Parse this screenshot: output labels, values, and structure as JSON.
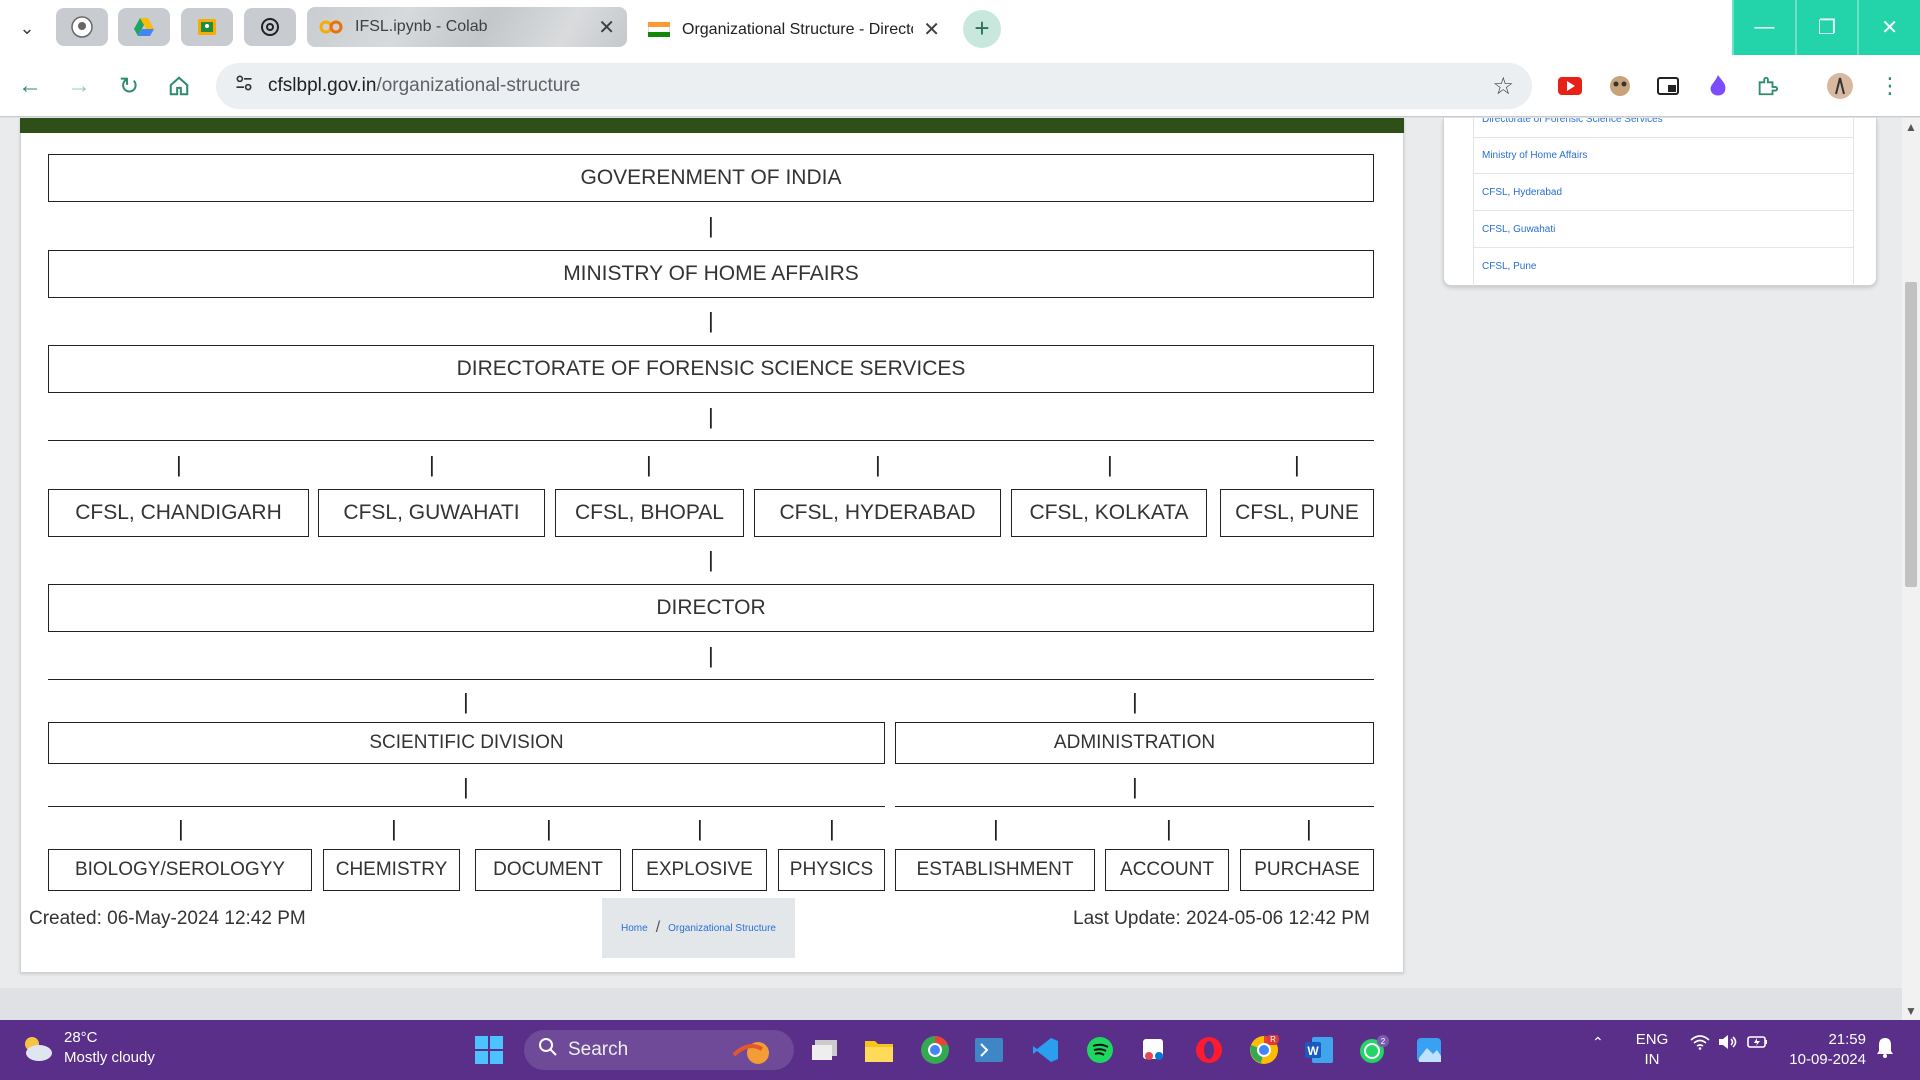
{
  "browser": {
    "tabs": [
      {
        "title": "IFSL.ipynb - Colab"
      },
      {
        "title": "Organizational Structure - Directorate"
      }
    ],
    "new_tab_label": "+",
    "url_host": "cfslbpl.gov.in",
    "url_path": "/organizational-structure"
  },
  "chart": {
    "level1": "GOVERENMENT OF INDIA",
    "level2": "MINISTRY OF HOME AFFAIRS",
    "level3": "DIRECTORATE OF FORENSIC SCIENCE SERVICES",
    "labs": [
      "CFSL, CHANDIGARH",
      "CFSL, GUWAHATI",
      "CFSL, BHOPAL",
      "CFSL, HYDERABAD",
      "CFSL, KOLKATA",
      "CFSL, PUNE"
    ],
    "director": "DIRECTOR",
    "scientific_division": "SCIENTIFIC DIVISION",
    "administration": "ADMINISTRATION",
    "scientific_units": [
      "BIOLOGY/SEROLOGYY",
      "CHEMISTRY",
      "DOCUMENT",
      "EXPLOSIVE",
      "PHYSICS"
    ],
    "admin_units": [
      "ESTABLISHMENT",
      "ACCOUNT",
      "PURCHASE"
    ],
    "connector": "|"
  },
  "page_footer": {
    "created": "Created:  06-May-2024  12:42  PM",
    "last_update": "Last  Update:  2024-05-06  12:42  PM",
    "breadcrumb": {
      "home": "Home",
      "separator": "/",
      "current": "Organizational Structure"
    }
  },
  "sidebar": {
    "links": [
      "Directorate of Forensic Science Services",
      "Ministry of Home Affairs",
      "CFSL, Hyderabad",
      "CFSL, Guwahati",
      "CFSL, Pune"
    ]
  },
  "taskbar": {
    "weather_temp": "28°C",
    "weather_desc": "Mostly cloudy",
    "search_label": "Search",
    "lang_line1": "ENG",
    "lang_line2": "IN",
    "time": "21:59",
    "date": "10-09-2024",
    "chrome_badge": "R",
    "whatsapp_badge": "2"
  },
  "colors": {
    "header_green": "#2e5018",
    "window_controls": "#23d3a9",
    "taskbar": "#5a2f8a",
    "back_to_top": "#e53935",
    "link": "#2a6ed4"
  }
}
